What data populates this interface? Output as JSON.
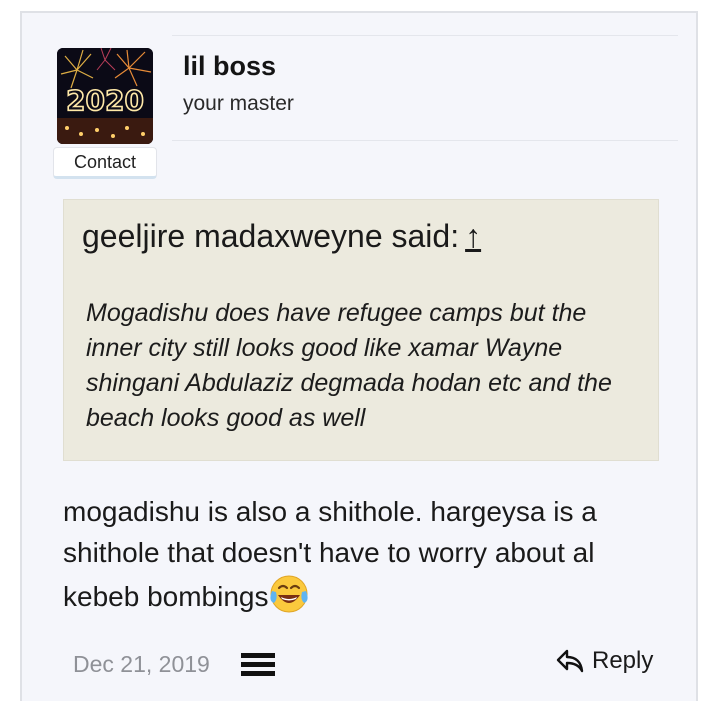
{
  "post": {
    "user": {
      "name": "lil boss",
      "title": "your master",
      "avatar_text": "2020",
      "contact_label": "Contact"
    },
    "quote": {
      "author_line": "geeljire madaxweyne said:",
      "arrow": "↑",
      "text": "Mogadishu does have refugee camps but the inner city still looks good like xamar Wayne shingani Abdulaziz degmada hodan etc and the beach looks good as well"
    },
    "message": {
      "text": "mogadishu is also a shithole. hargeysa is a shithole that doesn't have to worry about al kebeb bombings",
      "emoji": "face-with-tears-of-joy"
    },
    "footer": {
      "date": "Dec 21, 2019",
      "menu_icon": "hamburger-menu-icon",
      "reply_label": "Reply",
      "reply_icon": "reply-arrow-icon"
    }
  },
  "colors": {
    "page_bg": "#f5f6fb",
    "quote_bg": "#eceade",
    "date_text": "#8f9197",
    "contact_accent": "#d3e2ef"
  }
}
